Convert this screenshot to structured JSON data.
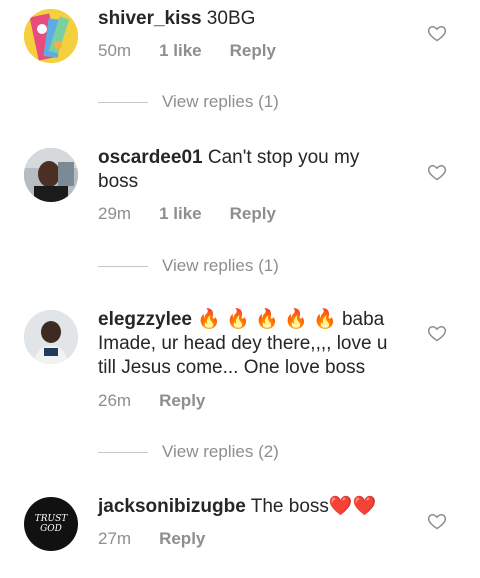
{
  "comments": [
    {
      "username": "shiver_kiss",
      "text": " 30BG",
      "time": "50m",
      "likes": "1 like",
      "reply": "Reply",
      "view_replies": "View replies (1)"
    },
    {
      "username": "oscardee01",
      "text": " Can't stop you my boss",
      "time": "29m",
      "likes": "1 like",
      "reply": "Reply",
      "view_replies": "View replies (1)"
    },
    {
      "username": "elegzzylee",
      "text_emoji": " 🔥 🔥 🔥 🔥 🔥",
      "text": " baba Imade, ur head dey there,,,, love u till Jesus come... One love boss",
      "time": "26m",
      "reply": "Reply",
      "view_replies": "View replies (2)"
    },
    {
      "username": "jacksonibizugbe",
      "text": " The boss",
      "text_emoji": "❤️❤️",
      "time": "27m",
      "reply": "Reply",
      "avatar_text": "TRUST GOD"
    }
  ],
  "icons": {
    "like": "heart-outline-icon"
  },
  "colors": {
    "text": "#262626",
    "meta": "#8e8e8e",
    "divider": "#c7c7c7"
  }
}
